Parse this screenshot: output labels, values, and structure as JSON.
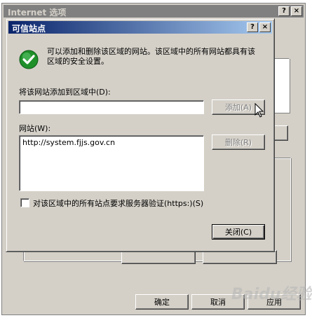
{
  "outer_window": {
    "title": "Internet 选项",
    "help_btn": "?",
    "close_btn": "×",
    "ok_label": "确定",
    "cancel_label": "取消",
    "apply_label": "应用"
  },
  "dialog": {
    "title": "可信站点",
    "help_btn": "?",
    "close_btn": "×",
    "info_text": "可以添加和删除该区域的网站。该区域中的所有网站都具有该区域的安全设置。",
    "add_label": "将该网站添加到区域中(D):",
    "add_input_value": "",
    "add_button": "添加(A)",
    "sites_label": "网站(W):",
    "sites": [
      "http://system.fjjs.gov.cn"
    ],
    "remove_button": "删除(R)",
    "https_checkbox_label": "对该区域中的所有站点要求服务器验证(https:)(S)",
    "https_checked": false,
    "close_button": "关闭(C)"
  },
  "watermark": "Baidu经验",
  "colors": {
    "title_active_start": "#0a246a",
    "title_active_end": "#a6caf0",
    "title_inactive": "#808080",
    "dialog_face": "#d4d0c8",
    "check_green": "#1f8f2a"
  }
}
